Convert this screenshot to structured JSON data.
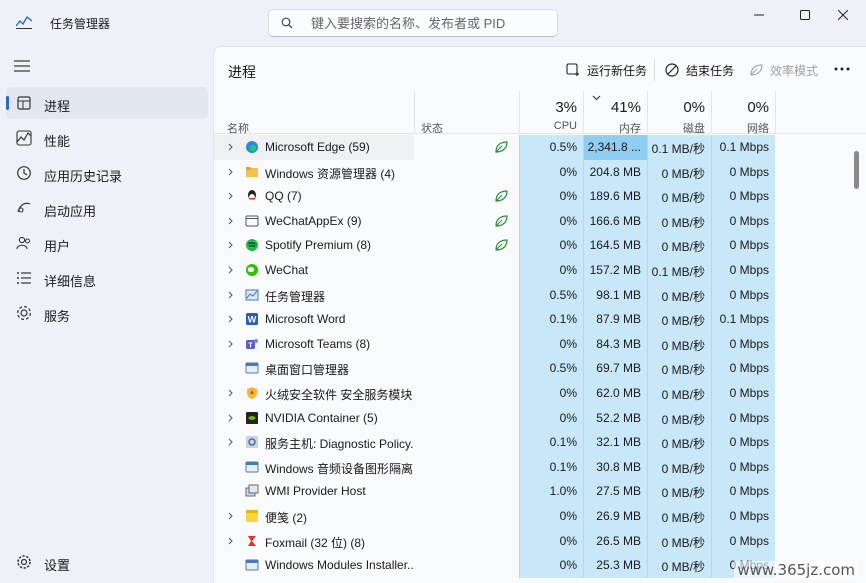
{
  "window": {
    "title": "任务管理器"
  },
  "search": {
    "placeholder": "键入要搜索的名称、发布者或 PID"
  },
  "sidebar": {
    "items": [
      {
        "label": "进程",
        "icon": "processes-icon",
        "active": true
      },
      {
        "label": "性能",
        "icon": "performance-icon"
      },
      {
        "label": "应用历史记录",
        "icon": "history-icon"
      },
      {
        "label": "启动应用",
        "icon": "startup-icon"
      },
      {
        "label": "用户",
        "icon": "users-icon"
      },
      {
        "label": "详细信息",
        "icon": "details-icon"
      },
      {
        "label": "服务",
        "icon": "services-icon"
      }
    ],
    "settings": "设置"
  },
  "toolbar": {
    "title": "进程",
    "run_new_task": "运行新任务",
    "end_task": "结束任务",
    "efficiency_mode": "效率模式"
  },
  "columns": {
    "name": "名称",
    "status": "状态",
    "cpu": {
      "pct": "3%",
      "label": "CPU"
    },
    "memory": {
      "pct": "41%",
      "label": "内存"
    },
    "disk": {
      "pct": "0%",
      "label": "磁盘"
    },
    "network": {
      "pct": "0%",
      "label": "网络"
    }
  },
  "processes": [
    {
      "name": "Microsoft Edge (59)",
      "icon": "edge-icon",
      "expand": true,
      "leaf": true,
      "cpu": "0.5%",
      "mem": "2,341.8 ...",
      "disk": "0.1 MB/秒",
      "net": "0.1 Mbps"
    },
    {
      "name": "Windows 资源管理器 (4)",
      "icon": "folder-icon",
      "expand": true,
      "leaf": false,
      "cpu": "0%",
      "mem": "204.8 MB",
      "disk": "0 MB/秒",
      "net": "0 Mbps"
    },
    {
      "name": "QQ (7)",
      "icon": "qq-icon",
      "expand": true,
      "leaf": true,
      "cpu": "0%",
      "mem": "189.6 MB",
      "disk": "0 MB/秒",
      "net": "0 Mbps"
    },
    {
      "name": "WeChatAppEx (9)",
      "icon": "window-icon",
      "expand": true,
      "leaf": true,
      "cpu": "0%",
      "mem": "166.6 MB",
      "disk": "0 MB/秒",
      "net": "0 Mbps"
    },
    {
      "name": "Spotify Premium (8)",
      "icon": "spotify-icon",
      "expand": true,
      "leaf": true,
      "cpu": "0%",
      "mem": "164.5 MB",
      "disk": "0 MB/秒",
      "net": "0 Mbps"
    },
    {
      "name": "WeChat",
      "icon": "wechat-icon",
      "expand": true,
      "leaf": false,
      "cpu": "0%",
      "mem": "157.2 MB",
      "disk": "0.1 MB/秒",
      "net": "0 Mbps"
    },
    {
      "name": "任务管理器",
      "icon": "taskmgr-icon",
      "expand": true,
      "leaf": false,
      "cpu": "0.5%",
      "mem": "98.1 MB",
      "disk": "0 MB/秒",
      "net": "0 Mbps"
    },
    {
      "name": "Microsoft Word",
      "icon": "word-icon",
      "expand": true,
      "leaf": false,
      "cpu": "0.1%",
      "mem": "87.9 MB",
      "disk": "0 MB/秒",
      "net": "0.1 Mbps"
    },
    {
      "name": "Microsoft Teams (8)",
      "icon": "teams-icon",
      "expand": true,
      "leaf": false,
      "cpu": "0%",
      "mem": "84.3 MB",
      "disk": "0 MB/秒",
      "net": "0 Mbps"
    },
    {
      "name": "桌面窗口管理器",
      "icon": "dwm-icon",
      "expand": false,
      "leaf": false,
      "cpu": "0.5%",
      "mem": "69.7 MB",
      "disk": "0 MB/秒",
      "net": "0 Mbps"
    },
    {
      "name": "火绒安全软件 安全服务模块 (...",
      "icon": "shield-icon",
      "expand": true,
      "leaf": false,
      "cpu": "0%",
      "mem": "62.0 MB",
      "disk": "0 MB/秒",
      "net": "0 Mbps"
    },
    {
      "name": "NVIDIA Container (5)",
      "icon": "nvidia-icon",
      "expand": true,
      "leaf": false,
      "cpu": "0%",
      "mem": "52.2 MB",
      "disk": "0 MB/秒",
      "net": "0 Mbps"
    },
    {
      "name": "服务主机: Diagnostic Policy...",
      "icon": "service-host-icon",
      "expand": true,
      "leaf": false,
      "cpu": "0.1%",
      "mem": "32.1 MB",
      "disk": "0 MB/秒",
      "net": "0 Mbps"
    },
    {
      "name": "Windows 音频设备图形隔离",
      "icon": "dwm-icon",
      "expand": false,
      "leaf": false,
      "cpu": "0.1%",
      "mem": "30.8 MB",
      "disk": "0 MB/秒",
      "net": "0 Mbps"
    },
    {
      "name": "WMI Provider Host",
      "icon": "wmi-icon",
      "expand": false,
      "leaf": false,
      "cpu": "1.0%",
      "mem": "27.5 MB",
      "disk": "0 MB/秒",
      "net": "0 Mbps"
    },
    {
      "name": "便笺 (2)",
      "icon": "sticky-notes-icon",
      "expand": true,
      "leaf": false,
      "cpu": "0%",
      "mem": "26.9 MB",
      "disk": "0 MB/秒",
      "net": "0 Mbps"
    },
    {
      "name": "Foxmail (32 位) (8)",
      "icon": "foxmail-icon",
      "expand": true,
      "leaf": false,
      "cpu": "0%",
      "mem": "26.5 MB",
      "disk": "0 MB/秒",
      "net": "0 Mbps"
    },
    {
      "name": "Windows Modules Installer...",
      "icon": "dwm-icon",
      "expand": false,
      "leaf": false,
      "cpu": "0%",
      "mem": "25.3 MB",
      "disk": "0 MB/秒",
      "net": "0 Mbps"
    }
  ],
  "watermark": "www.365jz.com"
}
